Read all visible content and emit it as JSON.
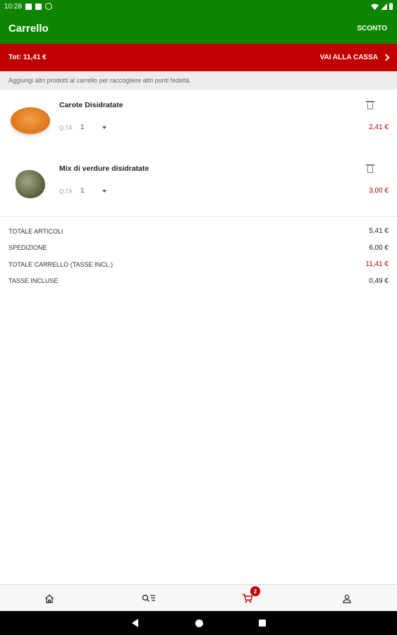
{
  "status_bar": {
    "time": "10:28",
    "icons": [
      "notification-square-icon",
      "sd-card-icon",
      "sync-icon",
      "wifi-icon",
      "signal-icon",
      "battery-icon"
    ]
  },
  "app_bar": {
    "title": "Carrello",
    "discount_label": "SCONTO"
  },
  "total_bar": {
    "total_label": "Tot: 11,41 €",
    "checkout_label": "VAI ALLA CASSA"
  },
  "info_message": "Aggiungi altri prodotti al carrello per raccogliere altri punti fedeltà.",
  "cart_items": [
    {
      "name": "Carote Disidratate",
      "qty_label": "Q.TÀ",
      "qty": "1",
      "price": "2,41 €",
      "image": "carrot-powder"
    },
    {
      "name": "Mix di verdure disidratate",
      "qty_label": "Q.TÀ",
      "qty": "1",
      "price": "3,00 €",
      "image": "vegetable-mix"
    }
  ],
  "summary": [
    {
      "label": "TOTALE ARTICOLI",
      "value": "5,41 €"
    },
    {
      "label": "SPEDIZIONE",
      "value": "6,00 €"
    },
    {
      "label": "TOTALE CARRELLO (TASSE INCL.)",
      "value": "11,41 €"
    },
    {
      "label": "TASSE INCLUSE",
      "value": "0,49 €"
    }
  ],
  "bottom_nav": {
    "items": [
      "home-icon",
      "search-list-icon",
      "cart-icon",
      "profile-icon"
    ],
    "cart_badge": "2",
    "active": "cart-icon"
  },
  "colors": {
    "brand_green": "#0d8500",
    "brand_red": "#c00000",
    "price_red": "#b30000"
  }
}
